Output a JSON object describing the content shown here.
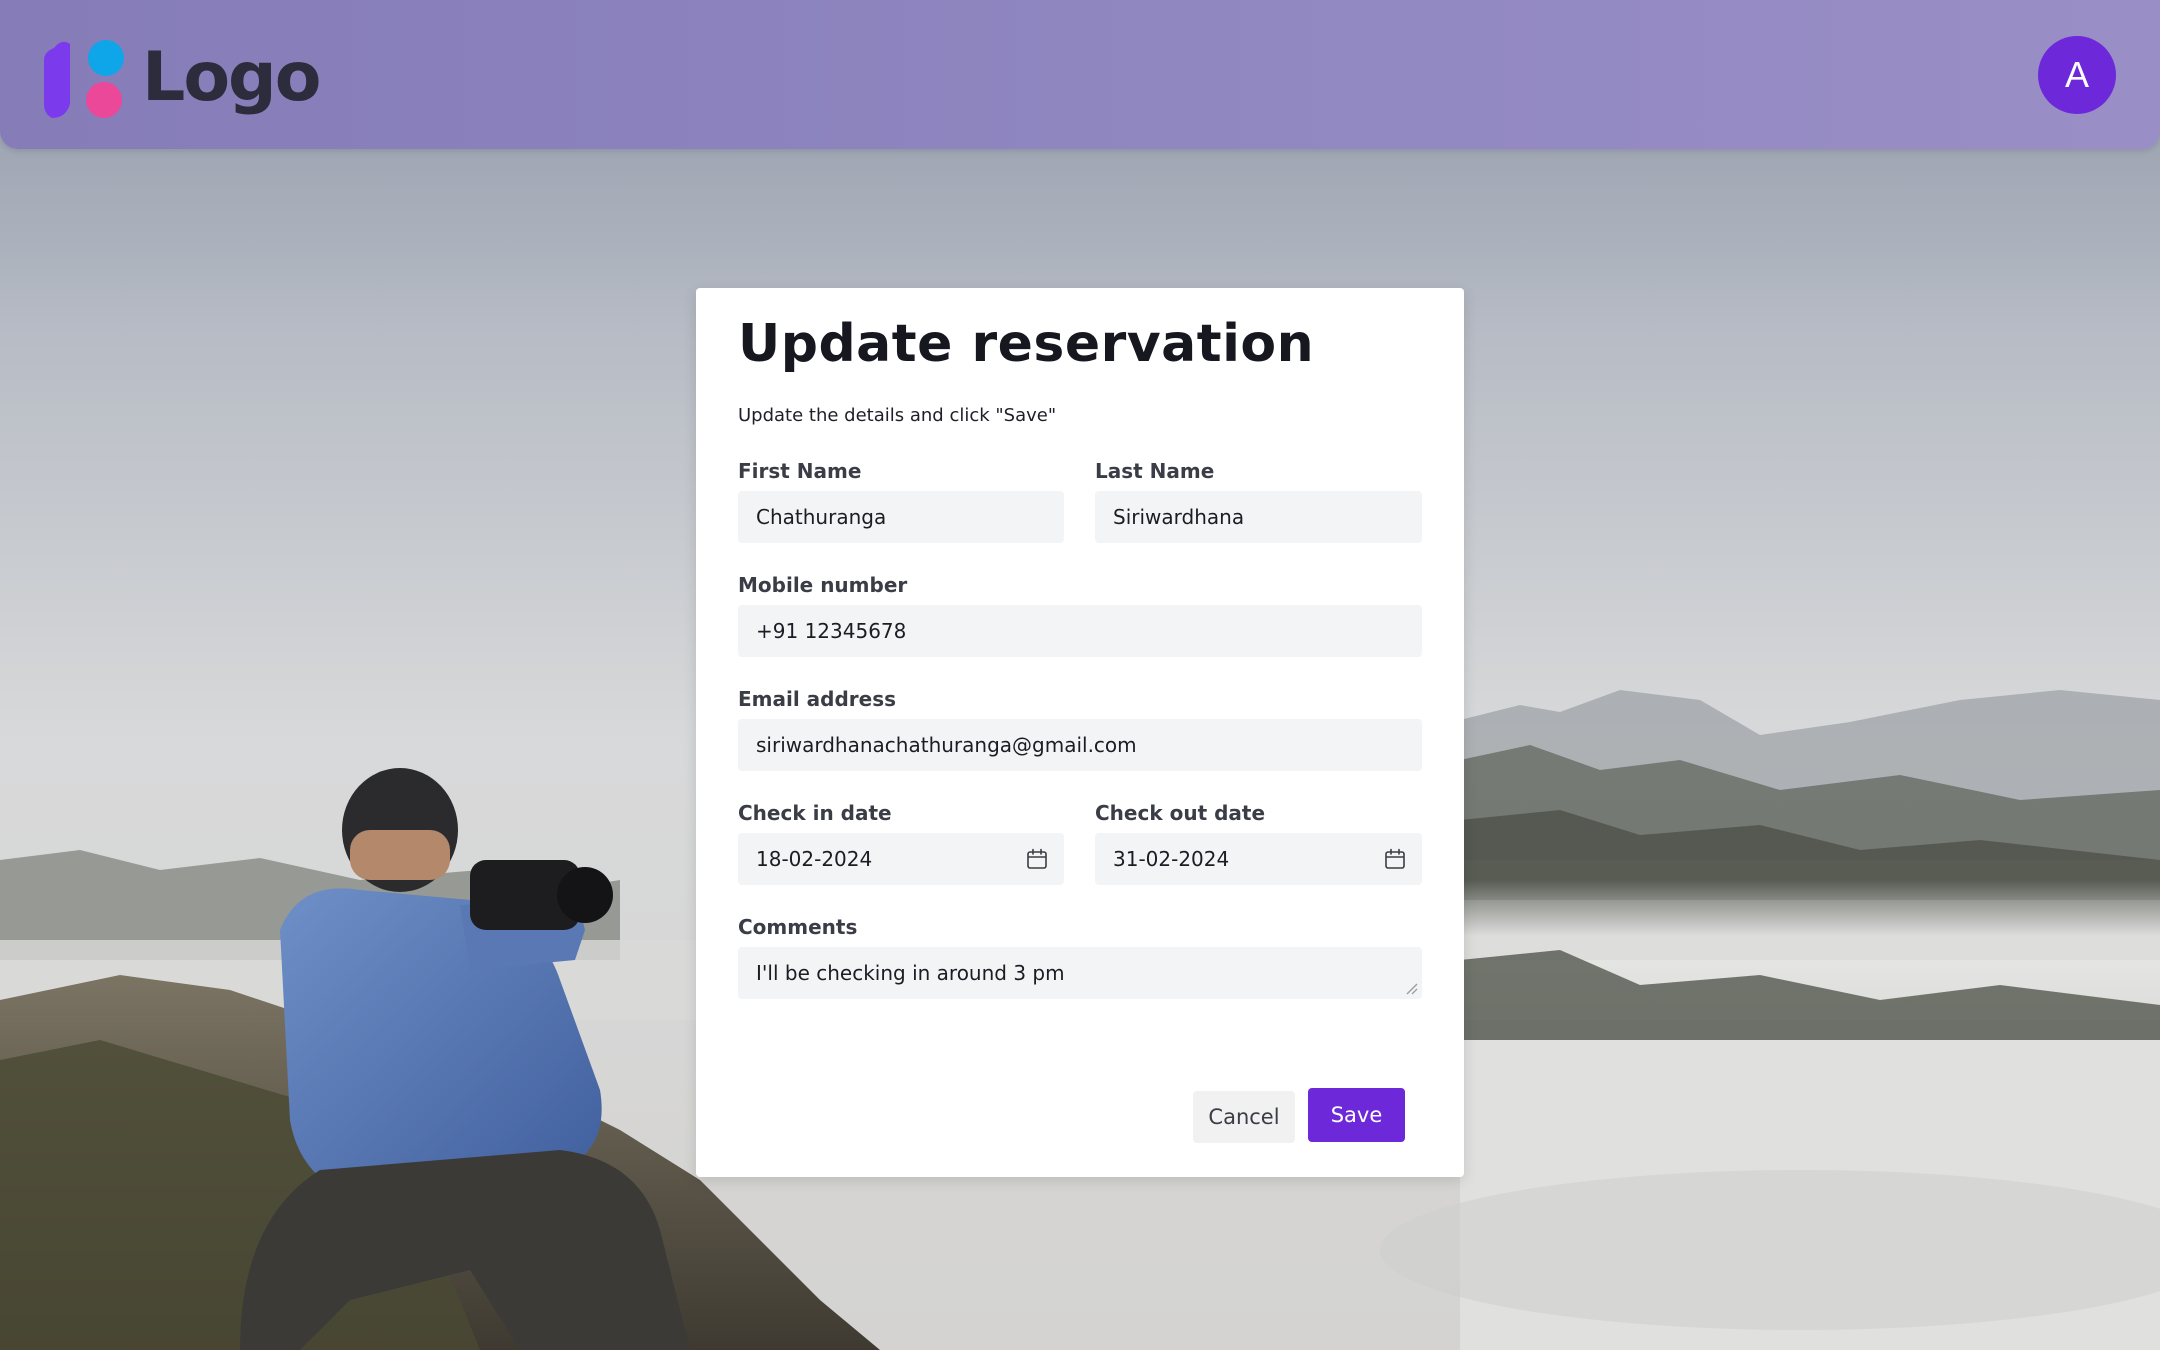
{
  "header": {
    "logo_text": "Logo",
    "avatar_initial": "A",
    "brand_color": "#6d28d9"
  },
  "form": {
    "title": "Update reservation",
    "subtitle": "Update the details and click \"Save\"",
    "first_name": {
      "label": "First Name",
      "value": "Chathuranga"
    },
    "last_name": {
      "label": "Last Name",
      "value": "Siriwardhana"
    },
    "mobile": {
      "label": "Mobile number",
      "value": "+91 12345678"
    },
    "email": {
      "label": "Email address",
      "value": "siriwardhanachathuranga@gmail.com"
    },
    "check_in": {
      "label": "Check in date",
      "value": "18-02-2024",
      "icon": "calendar-icon"
    },
    "check_out": {
      "label": "Check out date",
      "value": "31-02-2024",
      "icon": "calendar-icon"
    },
    "comments": {
      "label": "Comments",
      "value": "I'll be checking in around 3 pm"
    },
    "cancel_label": "Cancel",
    "save_label": "Save"
  }
}
